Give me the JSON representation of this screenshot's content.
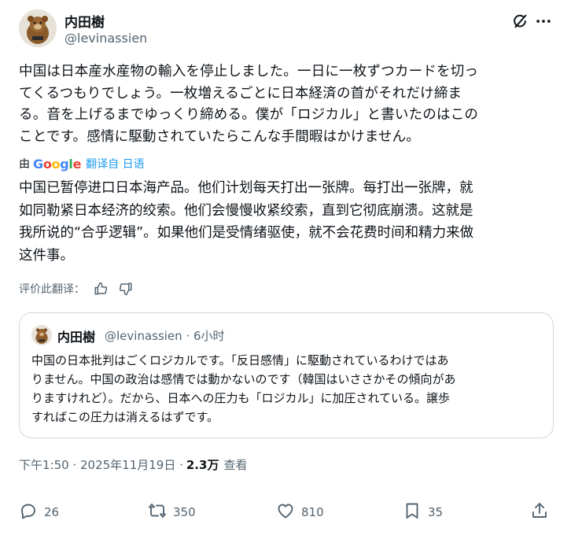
{
  "author": {
    "name": "内田樹",
    "handle": "@levinassien"
  },
  "post": {
    "original_lines": [
      "中国は日本産水産物の輸入を停止しました。一日に一枚ずつカードを切っ",
      "てくるつもりでしょう。一枚増えるごとに日本経済の首がそれだけ締ま",
      "る。音を上げるまでゆっくり締める。僕が「ロジカル」と書いたのはこの",
      "ことです。感情に駆動されていたらこんな手間暇はかけません。"
    ],
    "translation_by": "由",
    "translation_provider": "Google",
    "translated_from": "翻译自 日语",
    "translated_lines": [
      "中国已暂停进口日本海产品。他们计划每天打出一张牌。每打出一张牌，就",
      "如同勒紧日本经济的绞索。他们会慢慢收紧绞索，直到它彻底崩溃。这就是",
      "我所说的“合乎逻辑”。如果他们是受情绪驱使，就不会花费时间和精力来做",
      "这件事。"
    ],
    "rate_label": "评价此翻译："
  },
  "quoted": {
    "name": "内田樹",
    "meta": "@levinassien · 6小时",
    "lines": [
      "中国の日本批判はごくロジカルです。「反日感情」に駆動されているわけではあ",
      "りません。中国の政治は感情では動かないのです（韓国はいささかその傾向があ",
      "りますけれど）。だから、日本への圧力も「ロジカル」に加圧されている。譲歩",
      "すればこの圧力は消えるはずです。"
    ]
  },
  "timestamp": "下午1:50 · 2025年11月19日 ·",
  "views": {
    "count": "2.3万",
    "label": "查看"
  },
  "actions": {
    "replies": "26",
    "reposts": "350",
    "likes": "810",
    "bookmarks": "35"
  },
  "icons": [
    "grok-icon",
    "more-icon",
    "thumbs-up-icon",
    "thumbs-down-icon",
    "reply-icon",
    "repost-icon",
    "like-icon",
    "bookmark-icon",
    "share-icon"
  ],
  "colors": {
    "text": "#0f1419",
    "secondary": "#536471",
    "link": "#1d9bf0",
    "border": "#cfd9de"
  }
}
